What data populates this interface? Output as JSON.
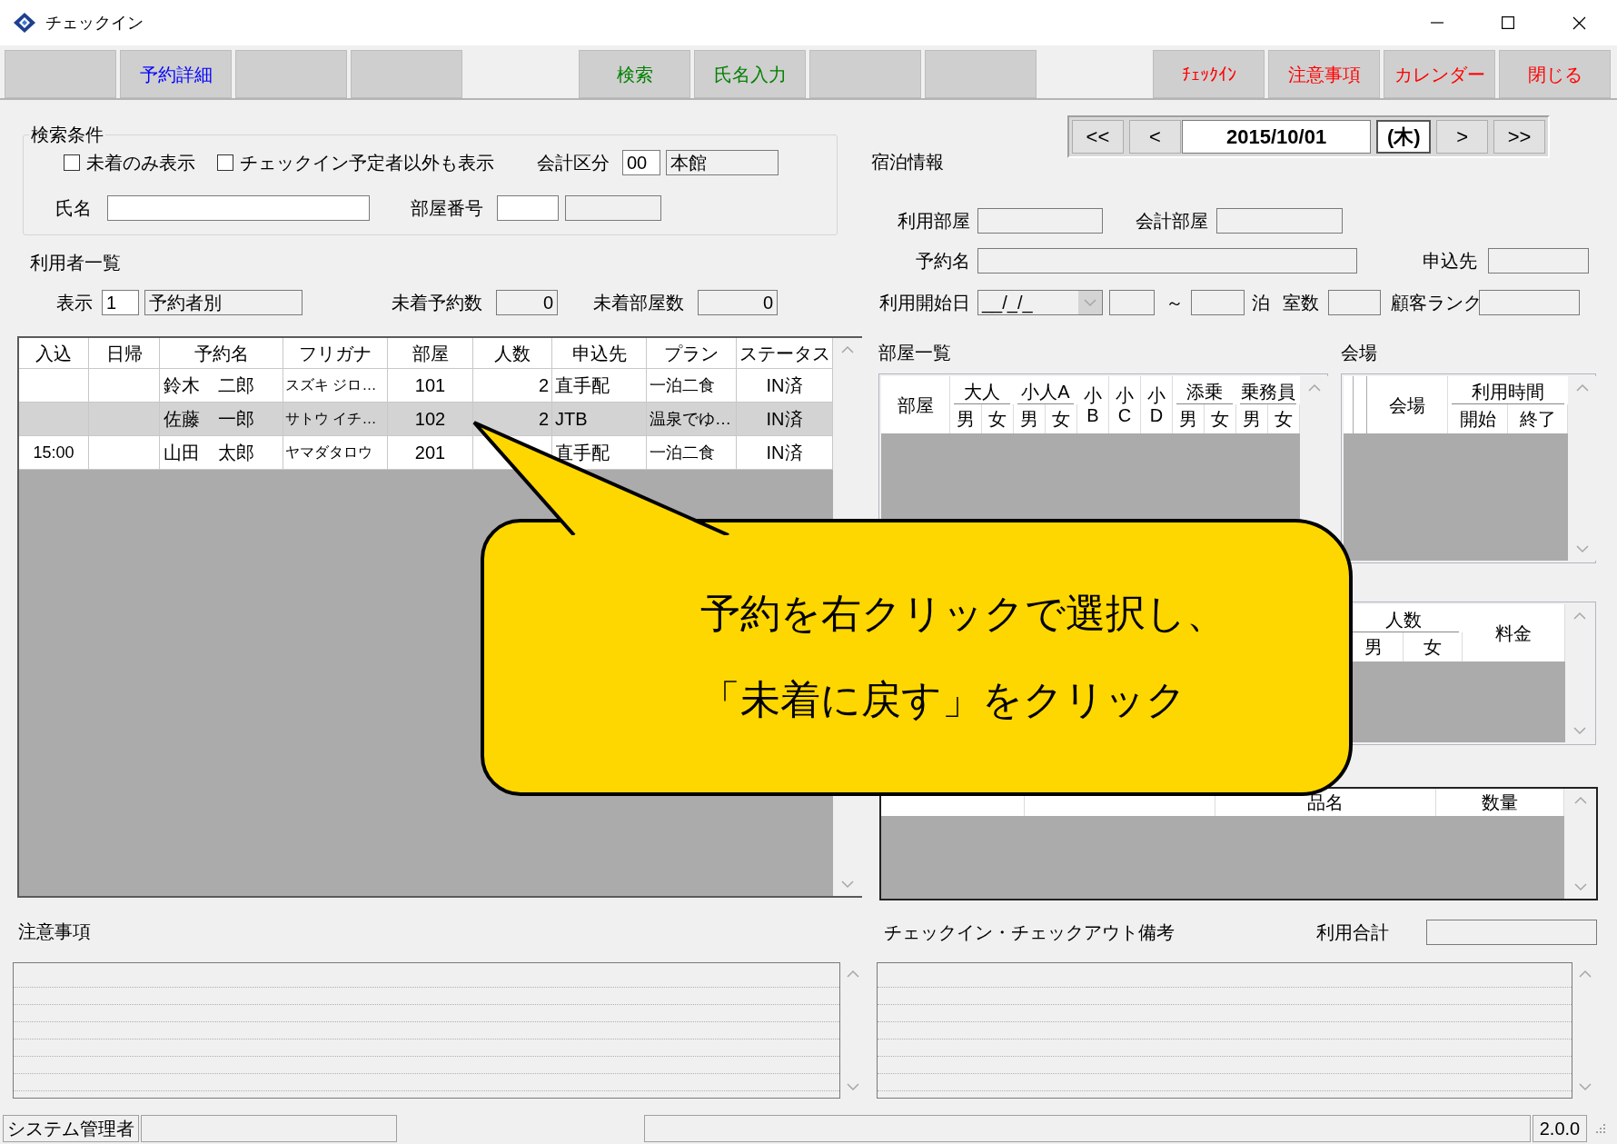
{
  "window": {
    "title": "チェックイン"
  },
  "toolbar": {
    "groups": [
      {
        "buttons": [
          {
            "kind": "blank"
          },
          {
            "kind": "button",
            "label": "予約詳細",
            "color": "#0000ff"
          },
          {
            "kind": "blank"
          },
          {
            "kind": "blank"
          }
        ]
      },
      {
        "buttons": [
          {
            "kind": "button",
            "label": "検索",
            "color": "#008000"
          },
          {
            "kind": "button",
            "label": "氏名入力",
            "color": "#008000"
          },
          {
            "kind": "blank"
          },
          {
            "kind": "blank"
          }
        ]
      },
      {
        "buttons": [
          {
            "kind": "button",
            "label": "ﾁｪｯｸｲﾝ",
            "color": "#ff0000"
          },
          {
            "kind": "button",
            "label": "注意事項",
            "color": "#ff0000"
          },
          {
            "kind": "button",
            "label": "カレンダー",
            "color": "#ff0000"
          },
          {
            "kind": "button",
            "label": "閉じる",
            "color": "#ff0000"
          }
        ]
      }
    ]
  },
  "search": {
    "title": "検索条件",
    "checkboxes": [
      {
        "label": "未着のみ表示",
        "checked": false
      },
      {
        "label": "チェックイン予定者以外も表示",
        "checked": false
      }
    ],
    "account": {
      "label": "会計区分",
      "code": "00",
      "name": "本館"
    },
    "name_field": {
      "label": "氏名"
    },
    "room_field": {
      "label": "部屋番号"
    }
  },
  "users": {
    "title": "利用者一覧",
    "display": {
      "label": "表示",
      "code": "1",
      "name": "予約者別"
    },
    "unarrived_bookings": {
      "label": "未着予約数",
      "value": "0"
    },
    "unarrived_rooms": {
      "label": "未着部屋数",
      "value": "0"
    },
    "table": {
      "columns": [
        "入込",
        "日帰",
        "予約名",
        "フリガナ",
        "部屋",
        "人数",
        "申込先",
        "プラン",
        "ステータス"
      ],
      "rows": [
        {
          "selected": false,
          "cells": [
            null,
            null,
            "鈴木　二郎",
            "スズキ ジロ…",
            "101",
            "2",
            "直手配",
            "一泊二食",
            "IN済"
          ]
        },
        {
          "selected": true,
          "cells": [
            null,
            null,
            "佐藤　一郎",
            "サトウ イチ…",
            "102",
            "2",
            "JTB",
            "温泉でゆ…",
            "IN済"
          ]
        },
        {
          "selected": false,
          "cells": [
            "15:00",
            null,
            "山田　太郎",
            "ヤマダタロウ",
            "201",
            null,
            "直手配",
            "一泊二食",
            "IN済"
          ]
        }
      ]
    }
  },
  "date_nav": {
    "prev": [
      "<<",
      "<"
    ],
    "date": "2015/10/01",
    "weekday": "(木)",
    "next": [
      ">",
      ">>"
    ]
  },
  "stay": {
    "title": "宿泊情報",
    "room_field": {
      "label": "利用部屋"
    },
    "account_room_field": {
      "label": "会計部屋"
    },
    "booking_name_field": {
      "label": "予約名"
    },
    "agent_field": {
      "label": "申込先"
    },
    "start_date": {
      "label": "利用開始日",
      "value": "__/_/_"
    },
    "range_separator": "～",
    "nights_label": "泊",
    "rooms_field": {
      "label": "室数"
    },
    "rank_field": {
      "label": "顧客ランク"
    }
  },
  "room_list": {
    "title": "部屋一覧",
    "columns": [
      {
        "label": "部屋"
      },
      {
        "label": "大人",
        "children": [
          "男",
          "女"
        ]
      },
      {
        "label": "小人A",
        "children": [
          "男",
          "女"
        ]
      },
      {
        "label": "小B"
      },
      {
        "label": "小C"
      },
      {
        "label": "小D"
      },
      {
        "label": "添乗",
        "children": [
          "男",
          "女"
        ]
      },
      {
        "label": "乗務員",
        "children": [
          "男",
          "女"
        ]
      }
    ]
  },
  "venue": {
    "title": "会場",
    "columns": [
      {
        "label": "会場"
      },
      {
        "label": "利用時間",
        "children": [
          "開始",
          "終了"
        ]
      }
    ]
  },
  "fees": {
    "columns": [
      {
        "label": "人数",
        "children": [
          "男",
          "女"
        ]
      },
      {
        "label": "料金"
      }
    ]
  },
  "items": {
    "columns": [
      null,
      null,
      "品名",
      "数量"
    ]
  },
  "notes": {
    "title": "注意事項"
  },
  "remarks": {
    "title": "チェックイン・チェックアウト備考",
    "total_label": "利用合計"
  },
  "status_bar": {
    "user": "システム管理者",
    "version": "2.0.0"
  },
  "callout": {
    "lines": [
      "予約を右クリックで選択し、",
      "「未着に戻す」をクリック"
    ]
  }
}
